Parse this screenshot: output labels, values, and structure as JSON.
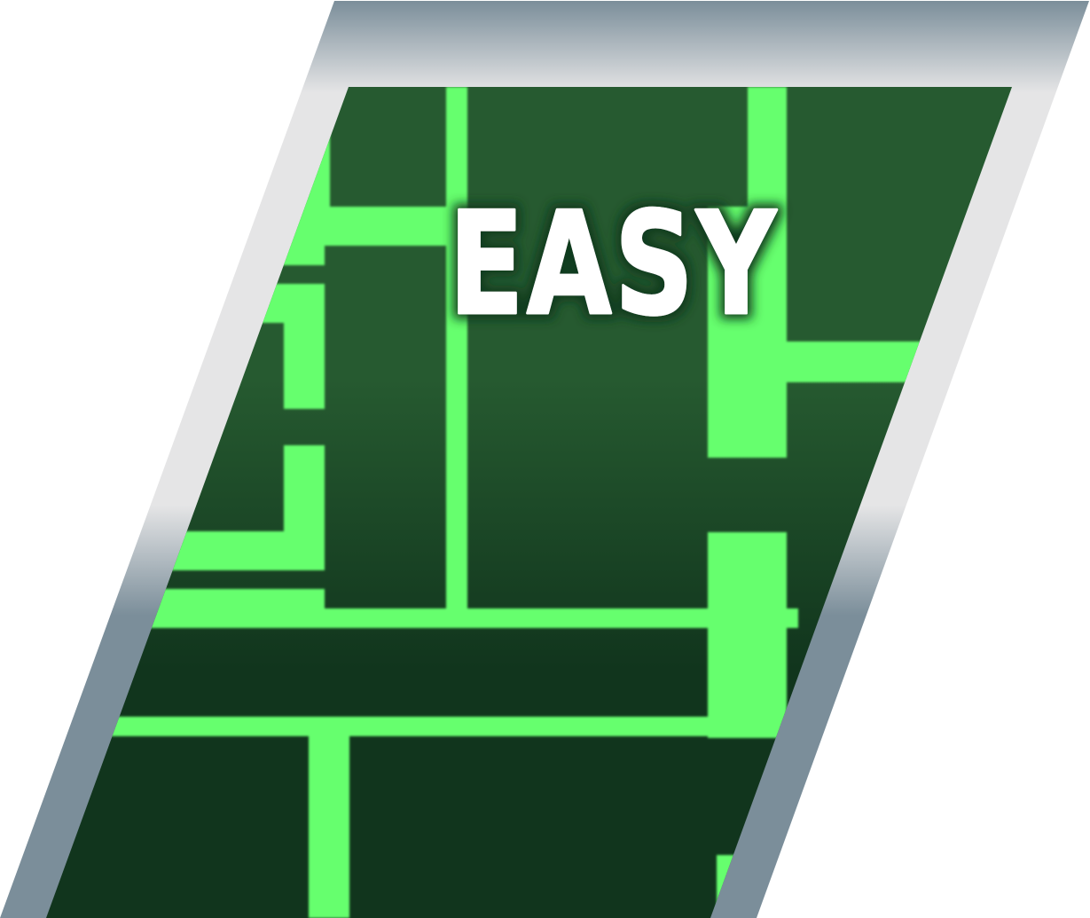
{
  "difficulty_button": {
    "label": "EASY",
    "colors": {
      "label_fill": "#ffffff",
      "label_glow": "#0f3a1d",
      "panel_top": "#265a30",
      "panel_bottom": "#11351d",
      "maze_path": "#66ff6e",
      "frame_light": "#e5e5e6",
      "frame_dark": "#7b8e9a"
    }
  }
}
